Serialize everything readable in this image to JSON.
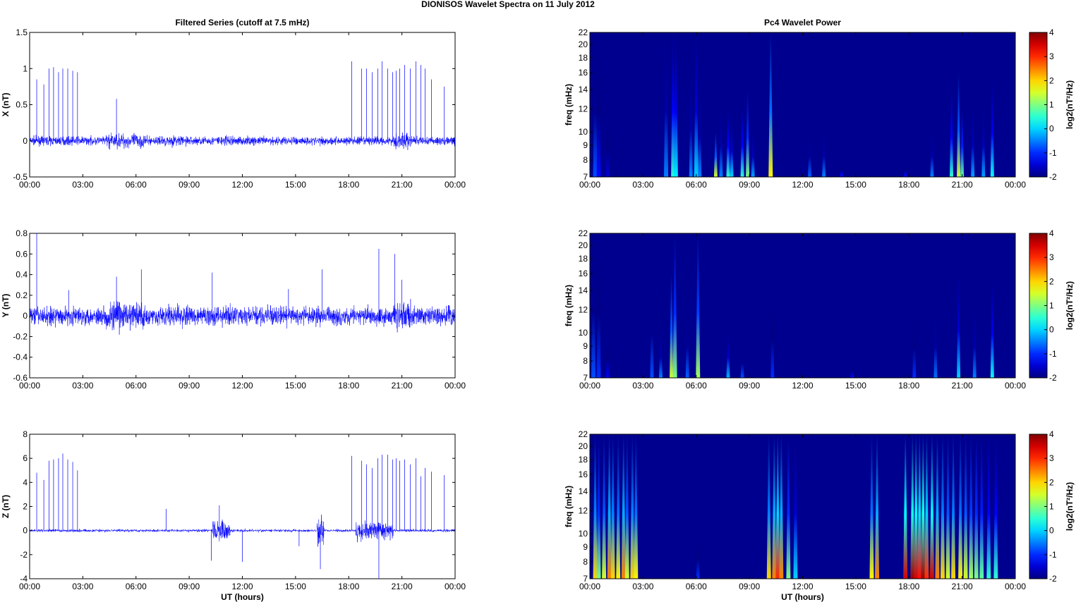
{
  "figure_title": "DIONISOS Wavelet Spectra on 11 July      2012",
  "chart_data": [
    {
      "type": "line",
      "id": "x",
      "title": "Filtered Series (cutoff at 7.5 mHz)",
      "ylabel": "X (nT)",
      "xlabel": "",
      "ylim": [
        -0.5,
        1.5
      ],
      "yticks": [
        "1.5",
        "1",
        "0.5",
        "0",
        "-0.5"
      ],
      "ytick_values": [
        1.5,
        1,
        0.5,
        0,
        -0.5
      ],
      "xticks": [
        "00:00",
        "03:00",
        "06:00",
        "09:00",
        "12:00",
        "15:00",
        "18:00",
        "21:00",
        "00:00"
      ],
      "xlim_hours": [
        0,
        24
      ],
      "noise_std": 0.04,
      "active_intervals": [
        [
          4.3,
          6.5,
          0.07
        ],
        [
          7.5,
          9.0,
          0.05
        ],
        [
          10.5,
          11.5,
          0.05
        ],
        [
          20.5,
          21.5,
          0.08
        ]
      ],
      "spikes": [
        [
          0.4,
          0.85
        ],
        [
          0.8,
          0.78
        ],
        [
          1.1,
          1.0
        ],
        [
          1.35,
          1.02
        ],
        [
          1.63,
          0.95
        ],
        [
          1.87,
          1.0
        ],
        [
          2.15,
          1.0
        ],
        [
          2.43,
          0.97
        ],
        [
          2.7,
          0.95
        ],
        [
          4.9,
          0.58
        ],
        [
          18.17,
          1.1
        ],
        [
          18.72,
          1.0
        ],
        [
          19.0,
          1.0
        ],
        [
          19.32,
          0.95
        ],
        [
          19.64,
          1.0
        ],
        [
          19.88,
          1.1
        ],
        [
          20.2,
          1.0
        ],
        [
          20.48,
          0.95
        ],
        [
          20.68,
          0.97
        ],
        [
          20.88,
          1.0
        ],
        [
          21.16,
          1.05
        ],
        [
          21.47,
          1.0
        ],
        [
          21.79,
          1.1
        ],
        [
          22.07,
          1.05
        ],
        [
          22.31,
          1.0
        ],
        [
          22.67,
          0.85
        ],
        [
          23.39,
          0.75
        ]
      ]
    },
    {
      "type": "line",
      "id": "y",
      "title": "",
      "ylabel": "Y (nT)",
      "xlabel": "",
      "ylim": [
        -0.6,
        0.8
      ],
      "yticks": [
        "0.8",
        "0.6",
        "0.4",
        "0.2",
        "0",
        "-0.2",
        "-0.4",
        "-0.6"
      ],
      "ytick_values": [
        0.8,
        0.6,
        0.4,
        0.2,
        0,
        -0.2,
        -0.4,
        -0.6
      ],
      "xticks": [
        "00:00",
        "03:00",
        "06:00",
        "09:00",
        "12:00",
        "15:00",
        "18:00",
        "21:00",
        "00:00"
      ],
      "xlim_hours": [
        0,
        24
      ],
      "noise_std": 0.06,
      "active_intervals": [
        [
          4.3,
          6.5,
          0.1
        ],
        [
          7.5,
          9.0,
          0.07
        ],
        [
          10.5,
          11.5,
          0.07
        ],
        [
          20.5,
          21.5,
          0.09
        ]
      ],
      "spikes": [
        [
          0.4,
          0.8
        ],
        [
          2.2,
          0.25
        ],
        [
          4.9,
          0.38
        ],
        [
          6.3,
          0.45
        ],
        [
          10.3,
          0.42
        ],
        [
          14.6,
          0.26
        ],
        [
          16.5,
          0.45
        ],
        [
          19.7,
          0.65
        ],
        [
          20.6,
          0.6
        ],
        [
          21.0,
          0.35
        ]
      ]
    },
    {
      "type": "line",
      "id": "z",
      "title": "",
      "ylabel": "Z (nT)",
      "xlabel": "UT (hours)",
      "ylim": [
        -4,
        8
      ],
      "yticks": [
        "8",
        "6",
        "4",
        "2",
        "0",
        "-2",
        "-4"
      ],
      "ytick_values": [
        8,
        6,
        4,
        2,
        0,
        -2,
        -4
      ],
      "xticks": [
        "00:00",
        "03:00",
        "06:00",
        "09:00",
        "12:00",
        "15:00",
        "18:00",
        "21:00",
        "00:00"
      ],
      "xlim_hours": [
        0,
        24
      ],
      "noise_std": 0.08,
      "active_intervals": [
        [
          10.3,
          11.3,
          0.6
        ],
        [
          16.2,
          16.6,
          0.8
        ],
        [
          18.4,
          20.5,
          0.5
        ]
      ],
      "spikes": [
        [
          0.4,
          4.8
        ],
        [
          0.8,
          4.2
        ],
        [
          1.1,
          5.8
        ],
        [
          1.35,
          5.9
        ],
        [
          1.63,
          6.0
        ],
        [
          1.87,
          6.4
        ],
        [
          2.15,
          5.9
        ],
        [
          2.43,
          5.7
        ],
        [
          2.7,
          5.0
        ],
        [
          7.7,
          1.8
        ],
        [
          10.7,
          2.1
        ],
        [
          18.17,
          6.2
        ],
        [
          18.72,
          5.8
        ],
        [
          19.0,
          5.5
        ],
        [
          19.32,
          5.2
        ],
        [
          19.64,
          6.0
        ],
        [
          19.88,
          6.3
        ],
        [
          20.2,
          6.3
        ],
        [
          20.48,
          5.9
        ],
        [
          20.68,
          6.0
        ],
        [
          20.88,
          5.8
        ],
        [
          21.16,
          5.9
        ],
        [
          21.47,
          5.5
        ],
        [
          21.79,
          6.0
        ],
        [
          22.07,
          4.5
        ],
        [
          22.31,
          5.2
        ],
        [
          22.67,
          4.9
        ],
        [
          23.39,
          4.6
        ]
      ],
      "neg_spikes": [
        [
          10.25,
          -2.5
        ],
        [
          12.0,
          -2.6
        ],
        [
          15.2,
          -1.3
        ],
        [
          16.4,
          -3.2
        ],
        [
          19.7,
          -4.0
        ]
      ]
    },
    {
      "type": "heatmap",
      "id": "sx",
      "title": "Pc4 Wavelet Power",
      "ylabel": "freq (mHz)",
      "xlabel": "",
      "yscale": "log",
      "ylim": [
        7,
        22
      ],
      "yticks": [
        "22",
        "20",
        "18",
        "16",
        "14",
        "12",
        "10",
        "9",
        "8",
        "7"
      ],
      "ytick_values": [
        22,
        20,
        18,
        16,
        14,
        12,
        10,
        9,
        8,
        7
      ],
      "xticks": [
        "00:00",
        "03:00",
        "06:00",
        "09:00",
        "12:00",
        "15:00",
        "18:00",
        "21:00",
        "00:00"
      ],
      "xlim_hours": [
        0,
        24
      ],
      "colorbar": {
        "label": "log2(nT²/Hz)",
        "range": [
          -2,
          4
        ],
        "ticks": [
          "4",
          "3",
          "2",
          "1",
          "0",
          "-1",
          "-2"
        ]
      },
      "background_power": -2,
      "streaks": [
        [
          0.3,
          -0.8,
          22
        ],
        [
          0.5,
          -1.2,
          22
        ],
        [
          1.0,
          -1.5,
          12
        ],
        [
          4.3,
          -0.5,
          22
        ],
        [
          4.7,
          0.5,
          22
        ],
        [
          4.85,
          0.2,
          22
        ],
        [
          5.7,
          -0.5,
          16
        ],
        [
          6.0,
          0.0,
          22
        ],
        [
          6.2,
          -0.5,
          14
        ],
        [
          7.1,
          1.5,
          10
        ],
        [
          7.4,
          -0.5,
          12
        ],
        [
          7.8,
          0.5,
          12
        ],
        [
          8.0,
          0.0,
          11
        ],
        [
          8.6,
          0.5,
          12
        ],
        [
          8.9,
          1.0,
          14
        ],
        [
          9.2,
          -0.3,
          10
        ],
        [
          10.2,
          1.8,
          22
        ],
        [
          12.4,
          -0.7,
          10
        ],
        [
          13.2,
          -0.5,
          10
        ],
        [
          14.2,
          -1.2,
          8
        ],
        [
          17.8,
          -1.2,
          8
        ],
        [
          19.3,
          -0.5,
          10
        ],
        [
          20.4,
          0.5,
          14
        ],
        [
          20.8,
          1.5,
          16
        ],
        [
          21.0,
          0.8,
          12
        ],
        [
          21.6,
          -0.3,
          12
        ],
        [
          22.2,
          -0.3,
          12
        ],
        [
          22.7,
          0.3,
          15
        ]
      ]
    },
    {
      "type": "heatmap",
      "id": "sy",
      "title": "",
      "ylabel": "freq (mHz)",
      "xlabel": "",
      "yscale": "log",
      "ylim": [
        7,
        22
      ],
      "yticks": [
        "22",
        "20",
        "18",
        "16",
        "14",
        "12",
        "10",
        "9",
        "8",
        "7"
      ],
      "ytick_values": [
        22,
        20,
        18,
        16,
        14,
        12,
        10,
        9,
        8,
        7
      ],
      "xticks": [
        "00:00",
        "03:00",
        "06:00",
        "09:00",
        "12:00",
        "15:00",
        "18:00",
        "21:00",
        "00:00"
      ],
      "xlim_hours": [
        0,
        24
      ],
      "colorbar": {
        "label": "log2(nT²/Hz)",
        "range": [
          -2,
          4
        ],
        "ticks": [
          "4",
          "3",
          "2",
          "1",
          "0",
          "-1",
          "-2"
        ]
      },
      "background_power": -2,
      "streaks": [
        [
          0.2,
          -0.8,
          22
        ],
        [
          0.5,
          -1.0,
          22
        ],
        [
          1.0,
          -1.3,
          10
        ],
        [
          3.5,
          -0.8,
          15
        ],
        [
          4.0,
          -0.5,
          10
        ],
        [
          4.6,
          1.5,
          16
        ],
        [
          4.8,
          1.0,
          22
        ],
        [
          5.5,
          -0.7,
          12
        ],
        [
          6.1,
          1.2,
          22
        ],
        [
          7.8,
          -0.2,
          10
        ],
        [
          8.6,
          -0.8,
          9
        ],
        [
          10.3,
          -1.0,
          14
        ],
        [
          14.8,
          -1.2,
          8
        ],
        [
          18.3,
          -1.0,
          12
        ],
        [
          19.5,
          -0.6,
          12
        ],
        [
          20.8,
          0.0,
          16
        ],
        [
          21.7,
          -0.5,
          12
        ],
        [
          22.7,
          0.3,
          15
        ]
      ]
    },
    {
      "type": "heatmap",
      "id": "sz",
      "title": "",
      "ylabel": "freq (mHz)",
      "xlabel": "UT (hours)",
      "yscale": "log",
      "ylim": [
        7,
        22
      ],
      "yticks": [
        "22",
        "20",
        "18",
        "16",
        "14",
        "12",
        "10",
        "9",
        "8",
        "7"
      ],
      "ytick_values": [
        22,
        20,
        18,
        16,
        14,
        12,
        10,
        9,
        8,
        7
      ],
      "xticks": [
        "00:00",
        "03:00",
        "06:00",
        "09:00",
        "12:00",
        "15:00",
        "18:00",
        "21:00",
        "00:00"
      ],
      "xlim_hours": [
        0,
        24
      ],
      "colorbar": {
        "label": "log2(nT²/Hz)",
        "range": [
          -2,
          4
        ],
        "ticks": [
          "4",
          "3",
          "2",
          "1",
          "0",
          "-1",
          "-2"
        ]
      },
      "background_power": -2,
      "streaks": [
        [
          0.3,
          2.0,
          22
        ],
        [
          0.5,
          1.0,
          22
        ],
        [
          0.8,
          1.5,
          22
        ],
        [
          1.1,
          2.5,
          22
        ],
        [
          1.3,
          2.0,
          22
        ],
        [
          1.6,
          1.8,
          22
        ],
        [
          1.9,
          2.5,
          22
        ],
        [
          2.1,
          1.5,
          22
        ],
        [
          2.4,
          2.0,
          22
        ],
        [
          2.6,
          1.8,
          22
        ],
        [
          6.1,
          -1.0,
          10
        ],
        [
          10.1,
          2.0,
          22
        ],
        [
          10.4,
          2.5,
          22
        ],
        [
          10.6,
          3.0,
          22
        ],
        [
          10.8,
          2.5,
          22
        ],
        [
          11.2,
          1.0,
          22
        ],
        [
          11.6,
          0.0,
          22
        ],
        [
          15.9,
          1.8,
          22
        ],
        [
          16.2,
          2.5,
          22
        ],
        [
          17.8,
          3.5,
          22
        ],
        [
          18.2,
          3.8,
          22
        ],
        [
          18.4,
          3.5,
          22
        ],
        [
          18.6,
          3.2,
          22
        ],
        [
          18.8,
          3.8,
          22
        ],
        [
          19.0,
          3.0,
          22
        ],
        [
          19.3,
          3.5,
          22
        ],
        [
          19.6,
          2.5,
          22
        ],
        [
          19.9,
          2.0,
          22
        ],
        [
          20.2,
          1.5,
          22
        ],
        [
          20.5,
          2.0,
          22
        ],
        [
          20.9,
          1.8,
          22
        ],
        [
          21.2,
          1.5,
          22
        ],
        [
          21.5,
          1.2,
          22
        ],
        [
          21.8,
          1.0,
          22
        ],
        [
          22.1,
          0.8,
          22
        ],
        [
          22.5,
          0.5,
          22
        ],
        [
          22.9,
          0.5,
          22
        ]
      ]
    }
  ]
}
